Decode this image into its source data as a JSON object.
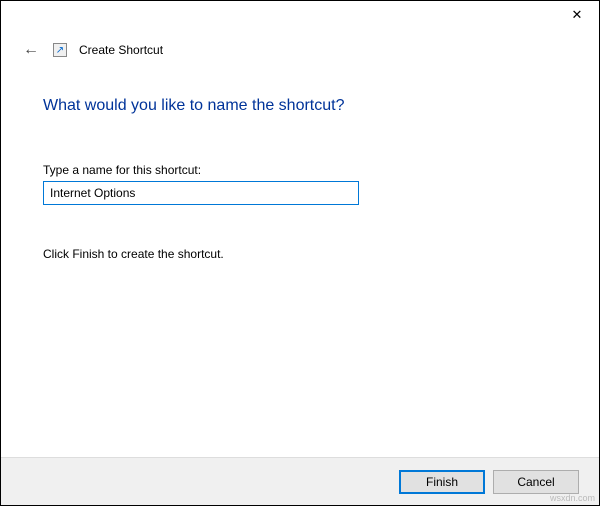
{
  "titlebar": {
    "close_icon": "✕"
  },
  "header": {
    "back_icon": "←",
    "wizard_icon": "↗",
    "title": "Create Shortcut"
  },
  "content": {
    "heading": "What would you like to name the shortcut?",
    "field_label": "Type a name for this shortcut:",
    "input_value": "Internet Options",
    "instruction": "Click Finish to create the shortcut."
  },
  "buttons": {
    "finish": "Finish",
    "cancel": "Cancel"
  },
  "watermark": "wsxdn.com"
}
